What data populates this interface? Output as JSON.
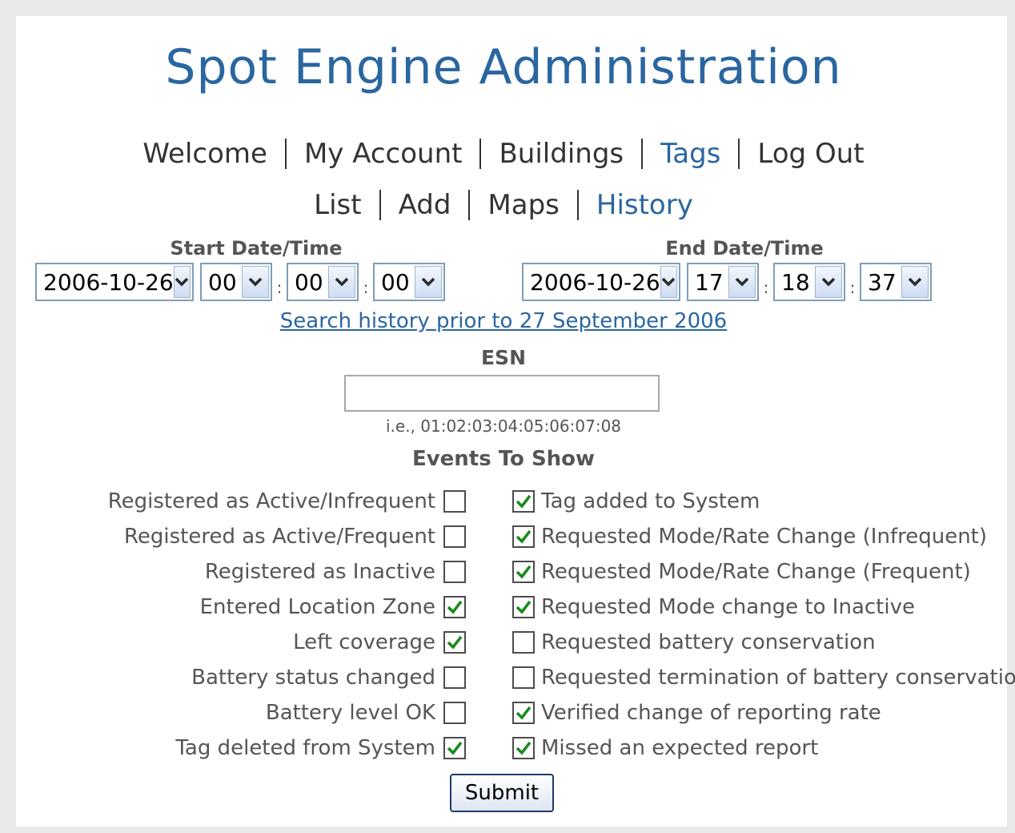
{
  "title": "Spot Engine Administration",
  "nav_primary": [
    "Welcome",
    "My Account",
    "Buildings",
    "Tags",
    "Log Out"
  ],
  "nav_primary_active": "Tags",
  "nav_secondary": [
    "List",
    "Add",
    "Maps",
    "History"
  ],
  "nav_secondary_active": "History",
  "start": {
    "label": "Start Date/Time",
    "date": "2006-10-26",
    "hour": "00",
    "minute": "00",
    "second": "00"
  },
  "end": {
    "label": "End Date/Time",
    "date": "2006-10-26",
    "hour": "17",
    "minute": "18",
    "second": "37"
  },
  "time_separator": ":",
  "history_link": "Search history prior to 27 September 2006",
  "esn": {
    "label": "ESN",
    "value": "",
    "hint": "i.e., 01:02:03:04:05:06:07:08"
  },
  "events_title": "Events To Show",
  "events_left": [
    {
      "label": "Registered as Active/Infrequent",
      "checked": false
    },
    {
      "label": "Registered as Active/Frequent",
      "checked": false
    },
    {
      "label": "Registered as Inactive",
      "checked": false
    },
    {
      "label": "Entered Location Zone",
      "checked": true
    },
    {
      "label": "Left coverage",
      "checked": true
    },
    {
      "label": "Battery status changed",
      "checked": false
    },
    {
      "label": "Battery level OK",
      "checked": false
    },
    {
      "label": "Tag deleted from System",
      "checked": true
    }
  ],
  "events_right": [
    {
      "label": "Tag added to System",
      "checked": true
    },
    {
      "label": "Requested Mode/Rate Change (Infrequent)",
      "checked": true
    },
    {
      "label": "Requested Mode/Rate Change (Frequent)",
      "checked": true
    },
    {
      "label": "Requested Mode change to Inactive",
      "checked": true
    },
    {
      "label": "Requested battery conservation",
      "checked": false
    },
    {
      "label": "Requested termination of battery conservation",
      "checked": false
    },
    {
      "label": "Verified change of reporting rate",
      "checked": true
    },
    {
      "label": "Missed an expected report",
      "checked": true
    }
  ],
  "submit_label": "Submit",
  "colors": {
    "accent": "#2a66a0",
    "check": "#1a8a1a"
  }
}
